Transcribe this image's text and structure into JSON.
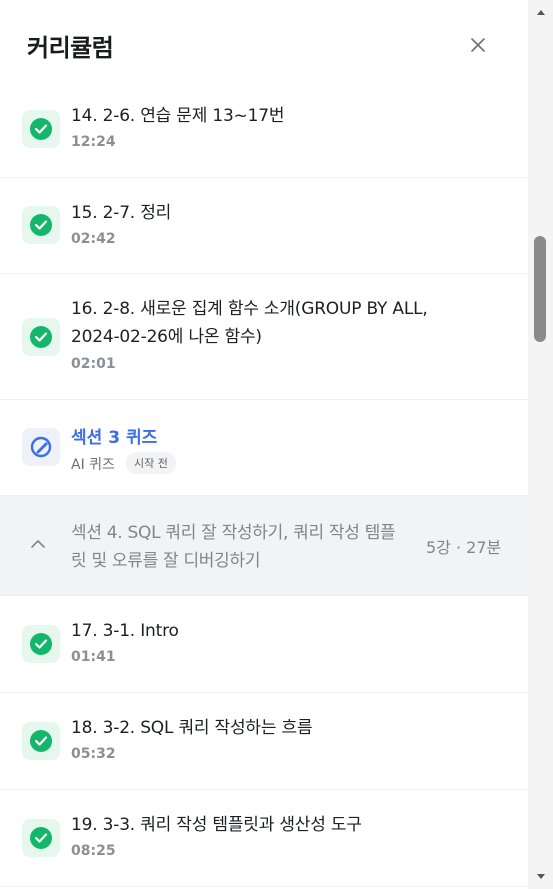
{
  "header": {
    "title": "커리큘럼",
    "close_label": "×"
  },
  "lessons_a": [
    {
      "title": "14. 2-6. 연습 문제 13~17번",
      "duration": "12:24"
    },
    {
      "title": "15. 2-7. 정리",
      "duration": "02:42"
    }
  ],
  "lesson_long": {
    "line1": "16. 2-8. 새로운 집계 함수 소개(GROUP BY ALL,",
    "line2": "2024-02-26에 나온 함수)",
    "duration": "02:01"
  },
  "quiz": {
    "title": "섹션 3 퀴즈",
    "type": "AI 퀴즈",
    "status": "시작 전"
  },
  "section": {
    "line1": "섹션 4. SQL 쿼리 잘 작성하기, 쿼리 작성 템플",
    "line2": "릿 및 오류를 잘 디버깅하기",
    "meta": "5강 · 27분"
  },
  "lessons_b": [
    {
      "title": "17. 3-1. Intro",
      "duration": "01:41"
    },
    {
      "title": "18. 3-2. SQL 쿼리 작성하는 흐름",
      "duration": "05:32"
    },
    {
      "title": "19. 3-3. 쿼리 작성 템플릿과 생산성 도구",
      "duration": "08:25"
    }
  ],
  "colors": {
    "accent": "#3b6ee8",
    "complete": "#12b76a",
    "section_bg": "#f1f3f5"
  }
}
